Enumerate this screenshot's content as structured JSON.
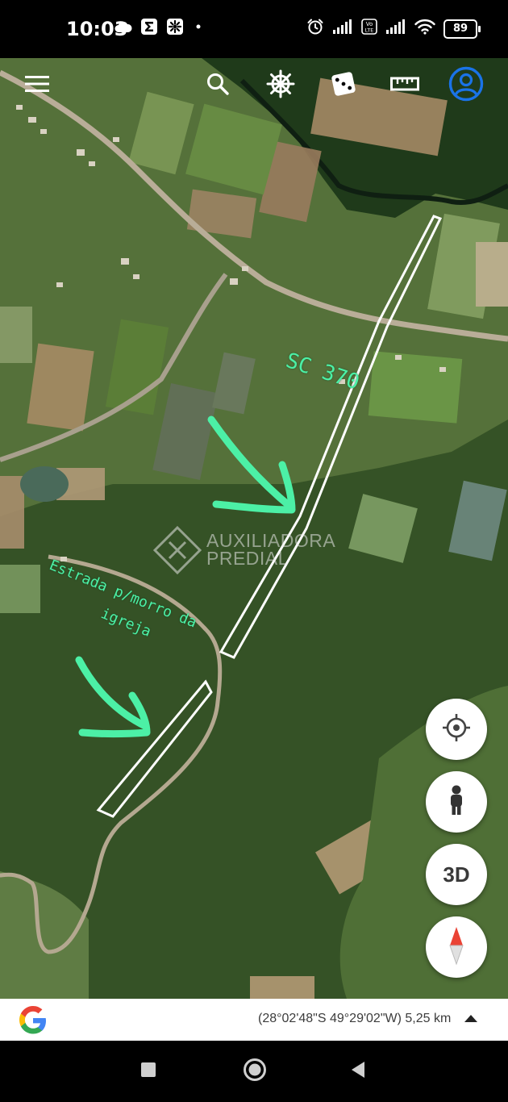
{
  "status_bar": {
    "time": "10:03",
    "battery_level": "89",
    "icons_left": [
      "cloud-icon",
      "sigma-app-icon",
      "flower-app-icon",
      "dot-icon"
    ],
    "icons_right": [
      "alarm-icon",
      "signal-icon",
      "volte-icon",
      "signal-icon",
      "wifi-icon",
      "battery-icon"
    ]
  },
  "toolbar": {
    "icons": [
      "menu-icon",
      "search-icon",
      "voyager-wheel-icon",
      "dice-icon",
      "ruler-icon",
      "account-icon"
    ]
  },
  "map": {
    "road_label": "SC 370",
    "annotation_line1": "Estrada p/morro da",
    "annotation_line2": "igreja",
    "watermark_line1": "AUXILIADORA",
    "watermark_line2": "PREDIAL"
  },
  "fabs": {
    "locate_icon": "crosshair-icon",
    "streetview_icon": "pegman-icon",
    "three_d_label": "3D",
    "compass_icon": "compass-icon"
  },
  "info_bar": {
    "coordinates": "(28°02'48\"S 49°29'02\"W) 5,25 km"
  },
  "nav_bar": {
    "icons": [
      "recents-square-icon",
      "home-circle-icon",
      "back-triangle-icon"
    ]
  },
  "colors": {
    "annotation_green": "#4cf0a6",
    "account_blue": "#1a73e8",
    "compass_red": "#ea4335"
  }
}
